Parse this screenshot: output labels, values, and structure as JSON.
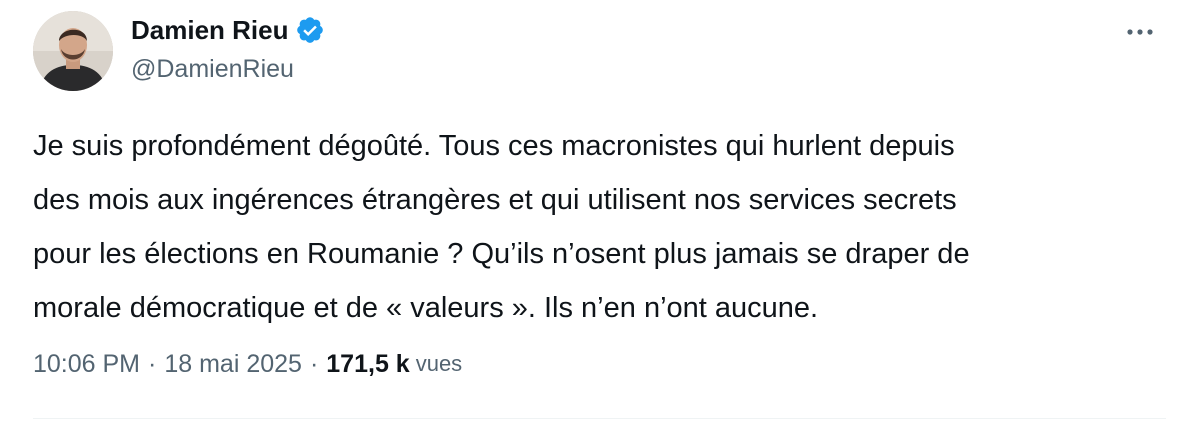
{
  "author": {
    "display_name": "Damien Rieu",
    "handle": "@DamienRieu",
    "verified_icon": "verified-badge-icon",
    "avatar_icon": "avatar"
  },
  "more_icon": "more-options-icon",
  "tweet": {
    "text": "Je suis profondément dégoûté. Tous ces macronistes qui hurlent depuis\ndes mois aux ingérences étrangères et qui utilisent nos services secrets\npour les élections en Roumanie ? Qu’ils n’osent plus jamais se draper de\nmorale démocratique et de « valeurs ». Ils n’en n’ont aucune."
  },
  "meta": {
    "time": "10:06 PM",
    "separator": "·",
    "date": "18 mai 2025",
    "views_count": "171,5 k",
    "views_label": "vues"
  },
  "colors": {
    "text": "#0f1419",
    "secondary": "#536471",
    "verified_blue": "#1d9bf0",
    "divider": "#eff3f4"
  }
}
